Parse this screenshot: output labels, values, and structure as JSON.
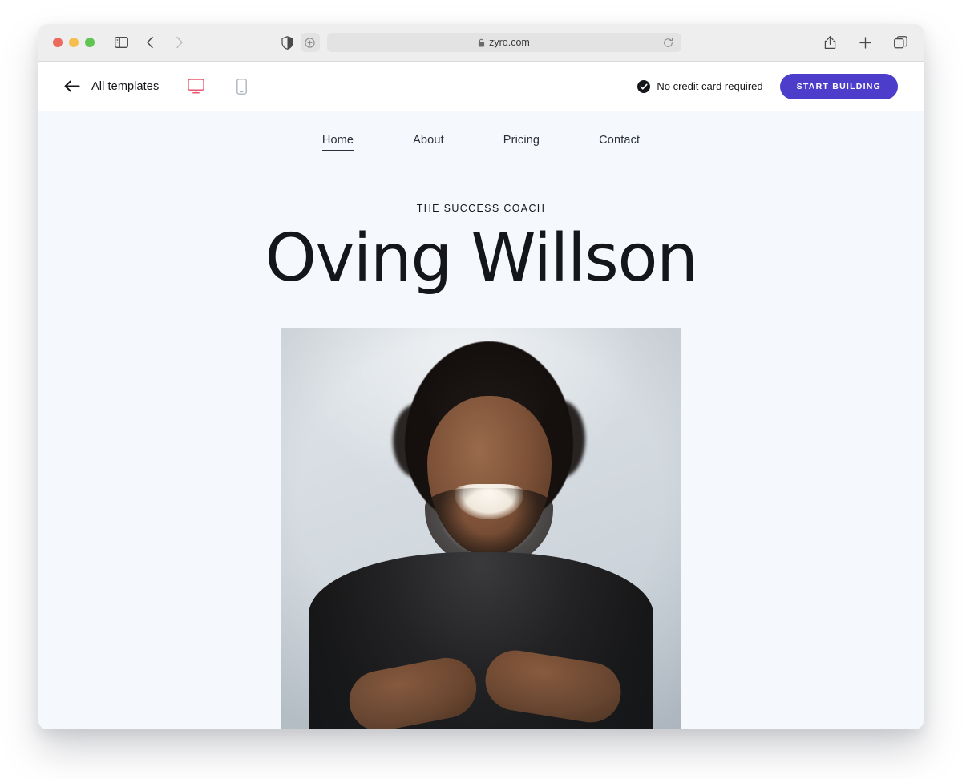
{
  "browser": {
    "traffic_lights": [
      "close",
      "minimize",
      "maximize"
    ],
    "sidebar_toggle_icon": "sidebar-icon",
    "back_icon": "chevron-left-icon",
    "forward_icon": "chevron-right-icon",
    "shield_icon": "shield-icon",
    "zoom_icon": "zoom-in-icon",
    "url": "zyro.com",
    "lock_icon": "lock-icon",
    "reload_icon": "reload-icon",
    "share_icon": "share-icon",
    "new_tab_icon": "plus-icon",
    "tabs_icon": "tabs-overview-icon"
  },
  "app_header": {
    "back_label": "All templates",
    "back_icon": "arrow-left-icon",
    "devices": [
      {
        "name": "desktop-view",
        "icon": "monitor-icon",
        "active": true
      },
      {
        "name": "mobile-view",
        "icon": "smartphone-icon",
        "active": false
      }
    ],
    "notice": "No credit card required",
    "notice_icon": "check-circle-icon",
    "cta_label": "START BUILDING",
    "cta_color": "#4C3DCB",
    "active_device_color": "#E8576F"
  },
  "site": {
    "nav": [
      {
        "label": "Home",
        "active": true
      },
      {
        "label": "About",
        "active": false
      },
      {
        "label": "Pricing",
        "active": false
      },
      {
        "label": "Contact",
        "active": false
      }
    ],
    "hero": {
      "eyebrow": "THE SUCCESS COACH",
      "title": "Oving Willson",
      "image_alt": "smiling-man-portrait",
      "background_color": "#F5F9FD"
    }
  }
}
